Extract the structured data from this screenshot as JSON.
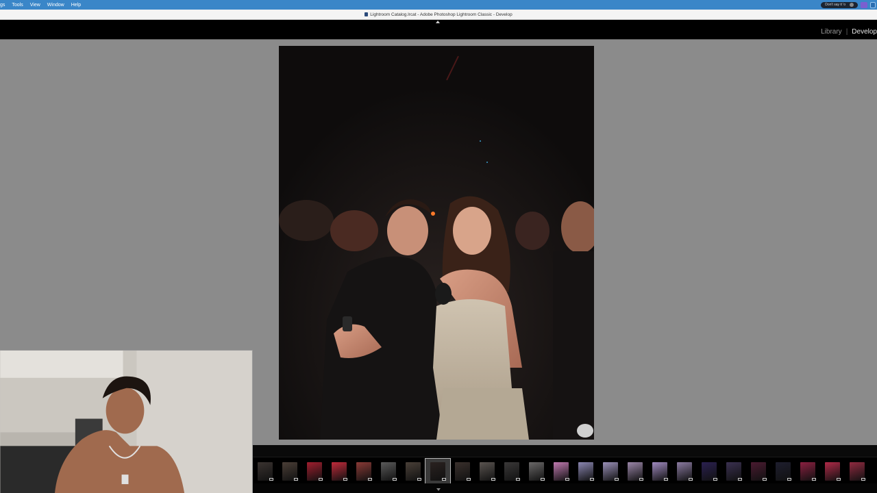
{
  "menubar": {
    "items": [
      "gs",
      "Tools",
      "View",
      "Window",
      "Help"
    ],
    "pill_text": "Don't say it 'o"
  },
  "window": {
    "title": "Lightroom Catalog.lrcat - Adobe Photoshop Lightroom Classic - Develop"
  },
  "module_picker": {
    "items": [
      "Library",
      "Develop"
    ],
    "active": "Develop"
  },
  "filmstrip": {
    "selected_index": 7,
    "thumbnails": [
      {
        "tone": "#3a3330"
      },
      {
        "tone": "#4a3e36"
      },
      {
        "tone": "#a01e2e"
      },
      {
        "tone": "#c02a3a"
      },
      {
        "tone": "#8a3a36"
      },
      {
        "tone": "#5a5a5a"
      },
      {
        "tone": "#4a4038"
      },
      {
        "tone": "#2a2220"
      },
      {
        "tone": "#3a302c"
      },
      {
        "tone": "#5a5450"
      },
      {
        "tone": "#3a3838"
      },
      {
        "tone": "#6a6868"
      },
      {
        "tone": "#c07ab0"
      },
      {
        "tone": "#8a86b0"
      },
      {
        "tone": "#9a90b8"
      },
      {
        "tone": "#9a86a8"
      },
      {
        "tone": "#a08ac0"
      },
      {
        "tone": "#8a7aa0"
      },
      {
        "tone": "#2a2050"
      },
      {
        "tone": "#3a3050"
      },
      {
        "tone": "#4a1a30"
      },
      {
        "tone": "#1e1e2e"
      },
      {
        "tone": "#8a2040"
      },
      {
        "tone": "#b02a48"
      },
      {
        "tone": "#902a40"
      }
    ]
  },
  "colors": {
    "menubar": "#3a86c8",
    "canvas": "#8b8b8b",
    "module_active": "#e8e8e8"
  }
}
